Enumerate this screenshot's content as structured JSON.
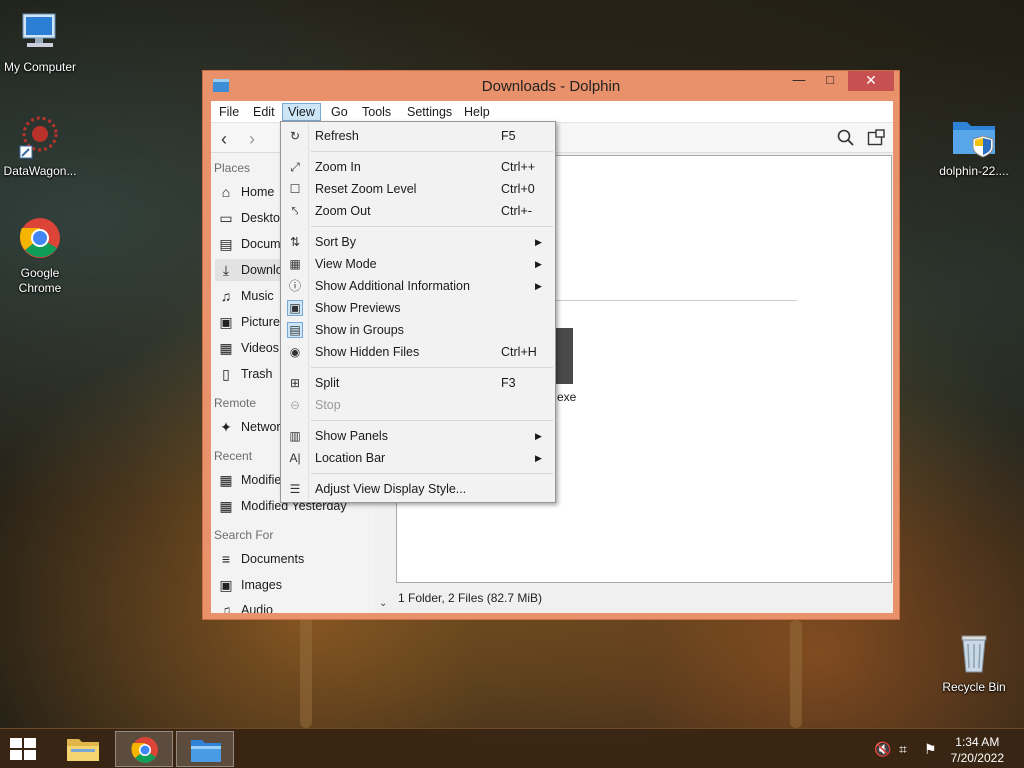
{
  "desktop": {
    "icons": [
      {
        "label": "My Computer"
      },
      {
        "label": "DataWagon..."
      },
      {
        "label": "Google Chrome"
      },
      {
        "label": "dolphin-22...."
      },
      {
        "label": "Recycle Bin"
      }
    ]
  },
  "window": {
    "title": "Downloads - Dolphin",
    "minimize": "—",
    "maximize": "□",
    "close": "✕"
  },
  "menubar": [
    "File",
    "Edit",
    "View",
    "Go",
    "Tools",
    "Settings",
    "Help"
  ],
  "places": {
    "sections": {
      "places": "Places",
      "remote": "Remote",
      "recent": "Recent",
      "search": "Search For"
    },
    "items": {
      "home": "Home",
      "desktop": "Desktop",
      "documents": "Documents",
      "downloads": "Downloads",
      "music": "Music",
      "pictures": "Pictures",
      "videos": "Videos",
      "trash": "Trash",
      "network": "Network",
      "modified_today": "Modified Today",
      "modified_yesterday": "Modified Yesterday",
      "search_documents": "Documents",
      "search_images": "Images",
      "search_audio": "Audio"
    }
  },
  "content": {
    "file_label": "exe",
    "status": "1 Folder, 2 Files (82.7 MiB)"
  },
  "view_menu": {
    "refresh": {
      "label": "Refresh",
      "shortcut": "F5"
    },
    "zoom_in": {
      "label": "Zoom In",
      "shortcut": "Ctrl++"
    },
    "reset_zoom": {
      "label": "Reset Zoom Level",
      "shortcut": "Ctrl+0"
    },
    "zoom_out": {
      "label": "Zoom Out",
      "shortcut": "Ctrl+-"
    },
    "sort_by": {
      "label": "Sort By"
    },
    "view_mode": {
      "label": "View Mode"
    },
    "show_additional": {
      "label": "Show Additional Information"
    },
    "show_previews": {
      "label": "Show Previews"
    },
    "show_groups": {
      "label": "Show in Groups"
    },
    "show_hidden": {
      "label": "Show Hidden Files",
      "shortcut": "Ctrl+H"
    },
    "split": {
      "label": "Split",
      "shortcut": "F3"
    },
    "stop": {
      "label": "Stop"
    },
    "show_panels": {
      "label": "Show Panels"
    },
    "location_bar": {
      "label": "Location Bar"
    },
    "adjust_view": {
      "label": "Adjust View Display Style..."
    }
  },
  "taskbar": {
    "time": "1:34 AM",
    "date": "7/20/2022"
  },
  "colors": {
    "window_frame": "#e8916a",
    "close_button": "#c75050",
    "menu_highlight": "#cde6f7"
  }
}
